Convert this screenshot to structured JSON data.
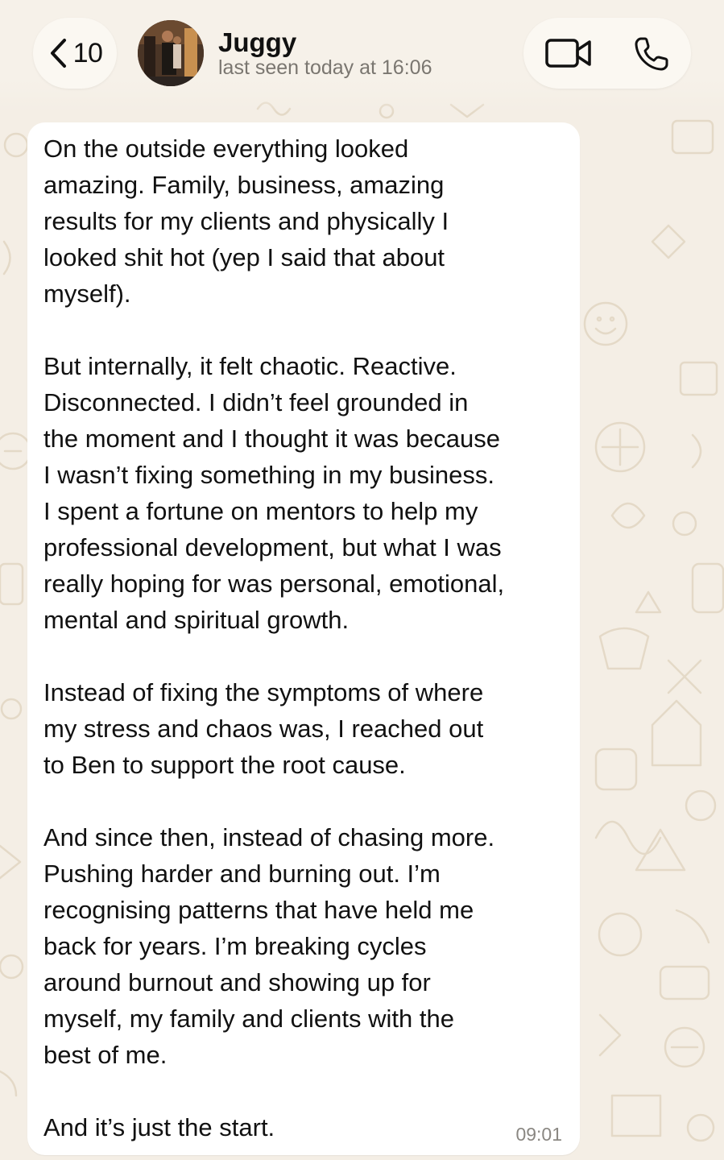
{
  "header": {
    "back_count": "10",
    "contact_name": "Juggy",
    "last_seen": "last seen today at 16:06",
    "icons": {
      "back": "chevron-left-icon",
      "video": "video-camera-icon",
      "phone": "phone-icon"
    }
  },
  "message": {
    "paragraphs": [
      "On the outside everything looked amazing. Family, business, amazing results for my clients and physically I looked shit hot (yep I said that about myself).",
      "But internally, it felt chaotic. Reactive. Disconnected. I didn’t feel grounded in the moment and I thought it was because I wasn’t fixing something in my business. I spent a fortune on mentors to help my professional development, but what I was really hoping for was personal, emotional, mental and spiritual growth.",
      "Instead of fixing the symptoms of where my stress and chaos was, I reached out to Ben to support the root cause.",
      "And since then, instead of chasing more. Pushing harder and burning out. I’m recognising patterns that have held me back for years. I’m breaking cycles around burnout and showing up for myself, my family and clients with the best of me.",
      "And it’s just the start."
    ],
    "text": "On the outside everything looked\namazing. Family, business, amazing\nresults for my clients and physically I\nlooked shit hot (yep I said that about\nmyself).\n\nBut internally, it felt chaotic. Reactive.\nDisconnected. I didn’t feel grounded in\nthe moment and I thought it was because\nI wasn’t fixing something in my business.\nI spent a fortune on mentors to help my\nprofessional development, but what I was\nreally hoping for was personal, emotional,\nmental and spiritual growth.\n\nInstead of fixing the symptoms of where\nmy stress and chaos was, I reached out\nto Ben to support the root cause.\n\nAnd since then, instead of chasing more.\nPushing harder and burning out. I’m\nrecognising patterns that have held me\nback for years. I’m breaking cycles\naround burnout and showing up for\nmyself, my family and clients with the\nbest of me.\n\nAnd it’s just the start.",
    "time": "09:01"
  },
  "colors": {
    "wallpaper": "#f4eee5",
    "doodle": "#e6dccb",
    "bubble": "#ffffff",
    "text": "#111111",
    "secondary_text": "#7a7670"
  }
}
